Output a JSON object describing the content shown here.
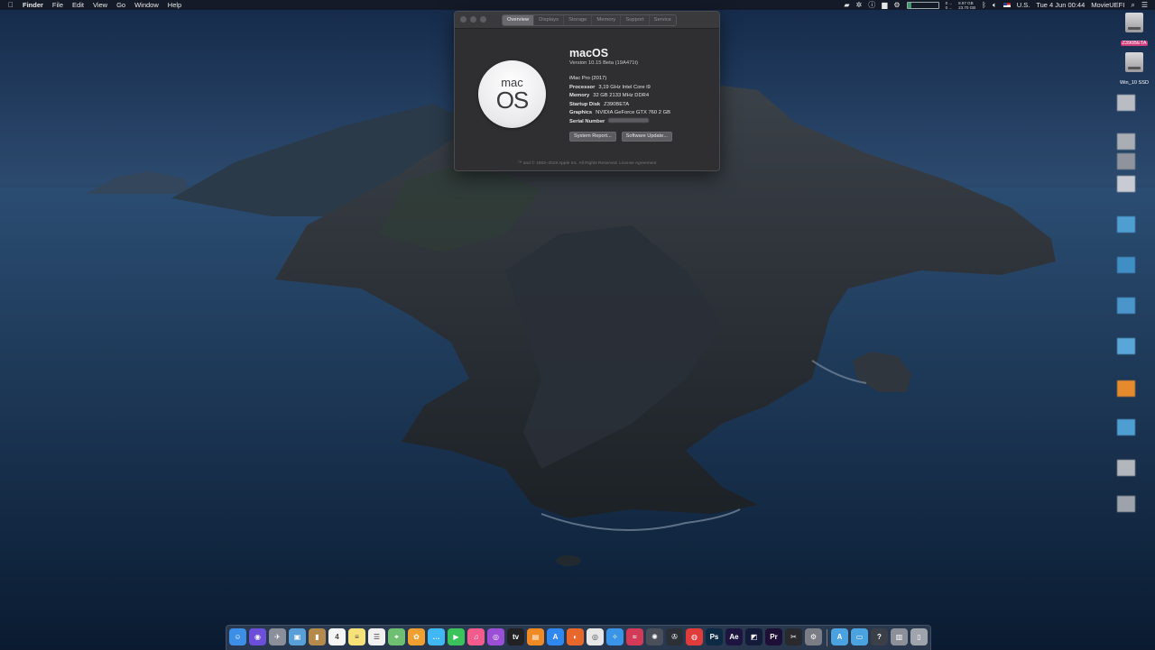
{
  "menubar": {
    "apple_icon": "apple-icon",
    "app_name": "Finder",
    "menus": [
      "File",
      "Edit",
      "View",
      "Go",
      "Window",
      "Help"
    ],
    "status_text_top": "8.97 GB",
    "status_text_bottom": "23.70 GB",
    "cpu_top": "0 ...",
    "cpu_bottom": "0 ...",
    "input_source": "U.S.",
    "clock": "Tue 4 Jun  00:44",
    "user": "MovieUEFI"
  },
  "about_window": {
    "tabs": [
      "Overview",
      "Displays",
      "Storage",
      "Memory",
      "Support",
      "Service"
    ],
    "active_tab": "Overview",
    "logo_line1": "mac",
    "logo_line2": "OS",
    "os_name": "macOS",
    "version": "Version 10.15 Beta (19A471t)",
    "model": "iMac Pro (2017)",
    "specs": [
      {
        "key": "Processor",
        "value": "3,19 GHz Intel Core i9"
      },
      {
        "key": "Memory",
        "value": "32 GB 2133 MHz DDR4"
      },
      {
        "key": "Startup Disk",
        "value": "Z390BETA"
      },
      {
        "key": "Graphics",
        "value": "NVIDIA GeForce GTX 760 2 GB"
      },
      {
        "key": "Serial Number",
        "value": ""
      }
    ],
    "buttons": {
      "system_report": "System Report...",
      "software_update": "Software Update..."
    },
    "copyright": "™ and © 1983–2019 Apple Inc. All Rights Reserved. License Agreement"
  },
  "desktop": {
    "drives": [
      {
        "label": "Z390BETA",
        "selected": true
      },
      {
        "label": "Win_10 SSD",
        "selected": false
      }
    ]
  },
  "dock": {
    "items": [
      {
        "icon": "finder-icon",
        "color": "#3d8ee6",
        "glyph": "☺"
      },
      {
        "icon": "siri-icon",
        "color": "#6b4fd8",
        "glyph": "◉"
      },
      {
        "icon": "launchpad-icon",
        "color": "#8a8f99",
        "glyph": "✈"
      },
      {
        "icon": "preview-icon",
        "color": "#5aa0d8",
        "glyph": "▣"
      },
      {
        "icon": "contacts-icon",
        "color": "#b58a4d",
        "glyph": "▮"
      },
      {
        "icon": "calendar-icon",
        "color": "#f5f5f5",
        "glyph": "4"
      },
      {
        "icon": "notes-icon",
        "color": "#f7e27a",
        "glyph": "≡"
      },
      {
        "icon": "reminders-icon",
        "color": "#f1f1f1",
        "glyph": "☰"
      },
      {
        "icon": "maps-icon",
        "color": "#6fbf73",
        "glyph": "⌖"
      },
      {
        "icon": "photos-icon",
        "color": "#f0a030",
        "glyph": "✿"
      },
      {
        "icon": "messages-icon",
        "color": "#3fb8f5",
        "glyph": "…"
      },
      {
        "icon": "facetime-icon",
        "color": "#39c35a",
        "glyph": "▶"
      },
      {
        "icon": "music-icon",
        "color": "#f25b8c",
        "glyph": "♫"
      },
      {
        "icon": "podcasts-icon",
        "color": "#9b4ed6",
        "glyph": "◎"
      },
      {
        "icon": "tv-icon",
        "color": "#222222",
        "glyph": "tv"
      },
      {
        "icon": "books-icon",
        "color": "#f08a24",
        "glyph": "▤"
      },
      {
        "icon": "app-store-icon",
        "color": "#2f87f0",
        "glyph": "A"
      },
      {
        "icon": "firefox-icon",
        "color": "#e8672a",
        "glyph": "◐"
      },
      {
        "icon": "chrome-icon",
        "color": "#e7e7e7",
        "glyph": "◎"
      },
      {
        "icon": "safari-icon",
        "color": "#3a95e8",
        "glyph": "✧"
      },
      {
        "icon": "lips-icon",
        "color": "#d23a58",
        "glyph": "≈"
      },
      {
        "icon": "davinci-icon",
        "color": "#4a4f5a",
        "glyph": "✺"
      },
      {
        "icon": "reel-icon",
        "color": "#2b2f36",
        "glyph": "✇"
      },
      {
        "icon": "lifesaver-icon",
        "color": "#e03c3c",
        "glyph": "◍"
      },
      {
        "icon": "photoshop-icon",
        "color": "#0c2a44",
        "glyph": "Ps"
      },
      {
        "icon": "after-effects-icon",
        "color": "#1d1440",
        "glyph": "Ae"
      },
      {
        "icon": "media-encoder-icon",
        "color": "#141a3a",
        "glyph": "◩"
      },
      {
        "icon": "premiere-icon",
        "color": "#1d0f36",
        "glyph": "Pr"
      },
      {
        "icon": "final-cut-icon",
        "color": "#2a2a2e",
        "glyph": "✂"
      },
      {
        "icon": "system-preferences-icon",
        "color": "#7a7d84",
        "glyph": "⚙"
      },
      {
        "icon": "applications-folder-icon",
        "color": "#4aa3e0",
        "glyph": "A"
      },
      {
        "icon": "documents-folder-icon",
        "color": "#4aa3e0",
        "glyph": "▭"
      },
      {
        "icon": "help-icon",
        "color": "#3a3f48",
        "glyph": "?"
      },
      {
        "icon": "downloads-stack-icon",
        "color": "#8d9099",
        "glyph": "▥"
      },
      {
        "icon": "trash-icon",
        "color": "#9fa3ab",
        "glyph": "▯"
      }
    ]
  }
}
